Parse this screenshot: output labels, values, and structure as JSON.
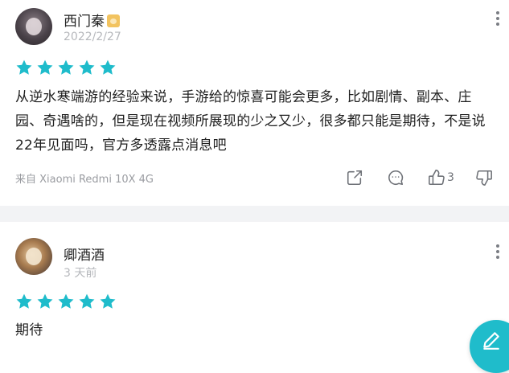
{
  "colors": {
    "star": "#1fbccb",
    "fab": "#1fbccb",
    "divider": "#f2f3f5"
  },
  "reviews": [
    {
      "username": "西门秦",
      "date": "2022/2/27",
      "rating": 5,
      "content": "从逆水寒端游的经验来说，手游给的惊喜可能会更多，比如剧情、副本、庄园、奇遇啥的，但是现在视频所展现的少之又少，很多都只能是期待，不是说22年见面吗，官方多透露点消息吧",
      "device": "来自 Xiaomi Redmi 10X 4G",
      "like_count": "3"
    },
    {
      "username": "卿酒酒",
      "date": "3 天前",
      "rating": 5,
      "content": "期待"
    }
  ],
  "icons": {
    "share": "share-icon",
    "comment": "comment-icon",
    "like": "thumbs-up-icon",
    "dislike": "thumbs-down-icon",
    "more": "more-vertical-icon",
    "fab": "edit-pen-icon"
  }
}
